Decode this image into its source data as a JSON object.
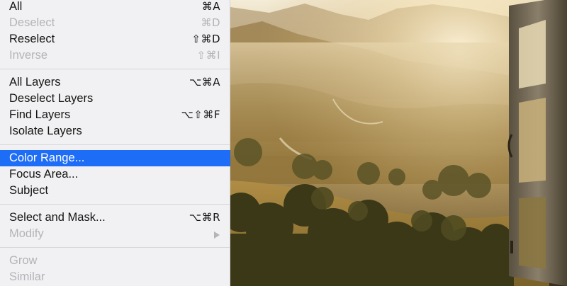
{
  "menu": {
    "sections": [
      {
        "items": [
          {
            "label": "All",
            "shortcut": "⌘A",
            "enabled": true
          },
          {
            "label": "Deselect",
            "shortcut": "⌘D",
            "enabled": false
          },
          {
            "label": "Reselect",
            "shortcut": "⇧⌘D",
            "enabled": true
          },
          {
            "label": "Inverse",
            "shortcut": "⇧⌘I",
            "enabled": false
          }
        ]
      },
      {
        "items": [
          {
            "label": "All Layers",
            "shortcut": "⌥⌘A",
            "enabled": true
          },
          {
            "label": "Deselect Layers",
            "shortcut": "",
            "enabled": true
          },
          {
            "label": "Find Layers",
            "shortcut": "⌥⇧⌘F",
            "enabled": true
          },
          {
            "label": "Isolate Layers",
            "shortcut": "",
            "enabled": true
          }
        ]
      },
      {
        "items": [
          {
            "label": "Color Range...",
            "shortcut": "",
            "enabled": true,
            "selected": true
          },
          {
            "label": "Focus Area...",
            "shortcut": "",
            "enabled": true
          },
          {
            "label": "Subject",
            "shortcut": "",
            "enabled": true
          }
        ]
      },
      {
        "items": [
          {
            "label": "Select and Mask...",
            "shortcut": "⌥⌘R",
            "enabled": true
          },
          {
            "label": "Modify",
            "shortcut": "",
            "enabled": false,
            "submenu": true
          }
        ]
      },
      {
        "items": [
          {
            "label": "Grow",
            "shortcut": "",
            "enabled": false
          },
          {
            "label": "Similar",
            "shortcut": "",
            "enabled": false
          }
        ]
      }
    ]
  },
  "colors": {
    "menu_background": "#f1f1f3",
    "highlight": "#1e6df6",
    "disabled_text": "#b4b4b8"
  },
  "icons": {
    "submenu": "chevron-right-icon"
  }
}
